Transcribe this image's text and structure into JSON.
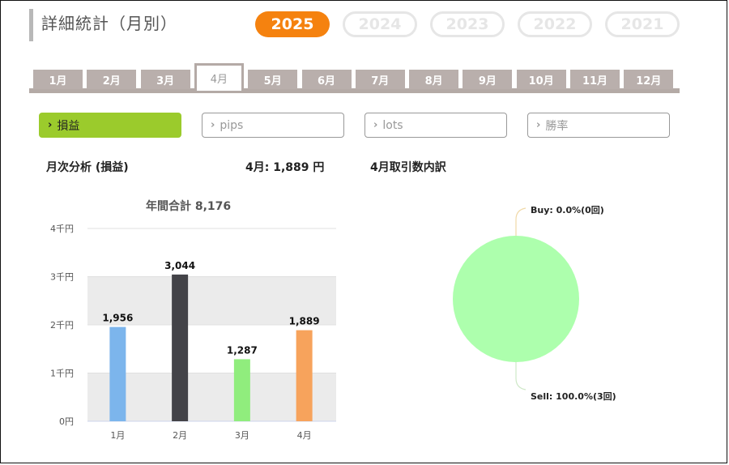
{
  "page": {
    "title": "詳細統計（月別）"
  },
  "years": [
    {
      "label": "2025",
      "active": true
    },
    {
      "label": "2024",
      "active": false
    },
    {
      "label": "2023",
      "active": false
    },
    {
      "label": "2022",
      "active": false
    },
    {
      "label": "2021",
      "active": false
    }
  ],
  "months": [
    {
      "label": "1月",
      "active": false
    },
    {
      "label": "2月",
      "active": false
    },
    {
      "label": "3月",
      "active": false
    },
    {
      "label": "4月",
      "active": true
    },
    {
      "label": "5月",
      "active": false
    },
    {
      "label": "6月",
      "active": false
    },
    {
      "label": "7月",
      "active": false
    },
    {
      "label": "8月",
      "active": false
    },
    {
      "label": "9月",
      "active": false
    },
    {
      "label": "10月",
      "active": false
    },
    {
      "label": "11月",
      "active": false
    },
    {
      "label": "12月",
      "active": false
    }
  ],
  "filters": [
    {
      "label": "損益",
      "active": true
    },
    {
      "label": "pips",
      "active": false
    },
    {
      "label": "lots",
      "active": false
    },
    {
      "label": "勝率",
      "active": false
    }
  ],
  "analysis": {
    "heading": "月次分析 (損益)",
    "month_value": "4月:  1,889 円",
    "breakdown_heading": "4月取引数内訳"
  },
  "colors": {
    "accent_orange": "#f5820f",
    "accent_green": "#9bcb2c",
    "tab_gray": "#b9afac"
  },
  "chart_data": [
    {
      "type": "bar",
      "title": "年間合計 8,176",
      "categories": [
        "1月",
        "2月",
        "3月",
        "4月"
      ],
      "values": [
        1956,
        3044,
        1287,
        1889
      ],
      "value_labels": [
        "1,956",
        "3,044",
        "1,287",
        "1,889"
      ],
      "bar_colors": [
        "#7cb5ec",
        "#434348",
        "#90ed7d",
        "#f7a35c"
      ],
      "yticks": [
        0,
        1000,
        2000,
        3000,
        4000
      ],
      "ytick_labels": [
        "0円",
        "1千円",
        "2千円",
        "3千円",
        "4千円"
      ],
      "ylim": [
        0,
        4000
      ],
      "grid": "alternating bands"
    },
    {
      "type": "pie",
      "slices": [
        {
          "name": "Buy",
          "value": 0.0,
          "label": "Buy: 0.0%(0回)"
        },
        {
          "name": "Sell",
          "value": 100.0,
          "label": "Sell: 100.0%(3回)"
        }
      ],
      "slice_colors": [
        "#f7a35c",
        "#adffad"
      ]
    }
  ]
}
